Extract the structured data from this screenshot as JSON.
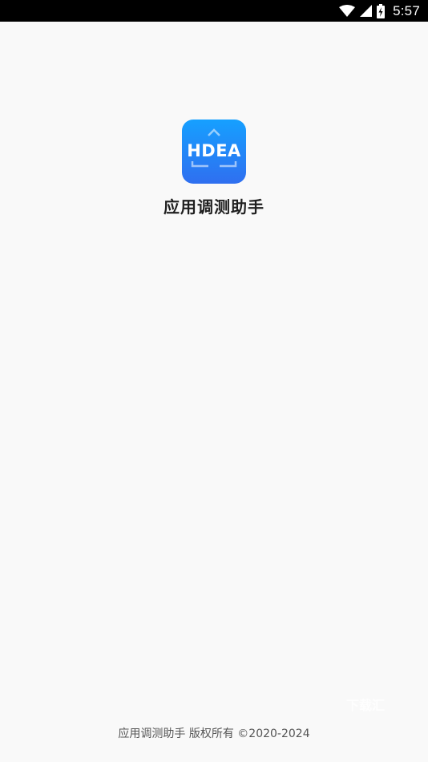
{
  "status_bar": {
    "time": "5:57",
    "icons": [
      "wifi-icon",
      "cellular-signal-icon",
      "battery-charging-icon"
    ]
  },
  "app": {
    "icon_text": "HDEA",
    "icon_colors": {
      "top": "#16a0ff",
      "bottom": "#2f6ff0"
    },
    "name": "应用调测助手"
  },
  "watermark": {
    "text": "下载汇"
  },
  "footer": {
    "copyright": "应用调测助手 版权所有 ©2020-2024"
  },
  "colors": {
    "background": "#f9f9f9",
    "status_bar": "#000000",
    "title_text": "#1f1f1f",
    "footer_text": "#555555"
  }
}
